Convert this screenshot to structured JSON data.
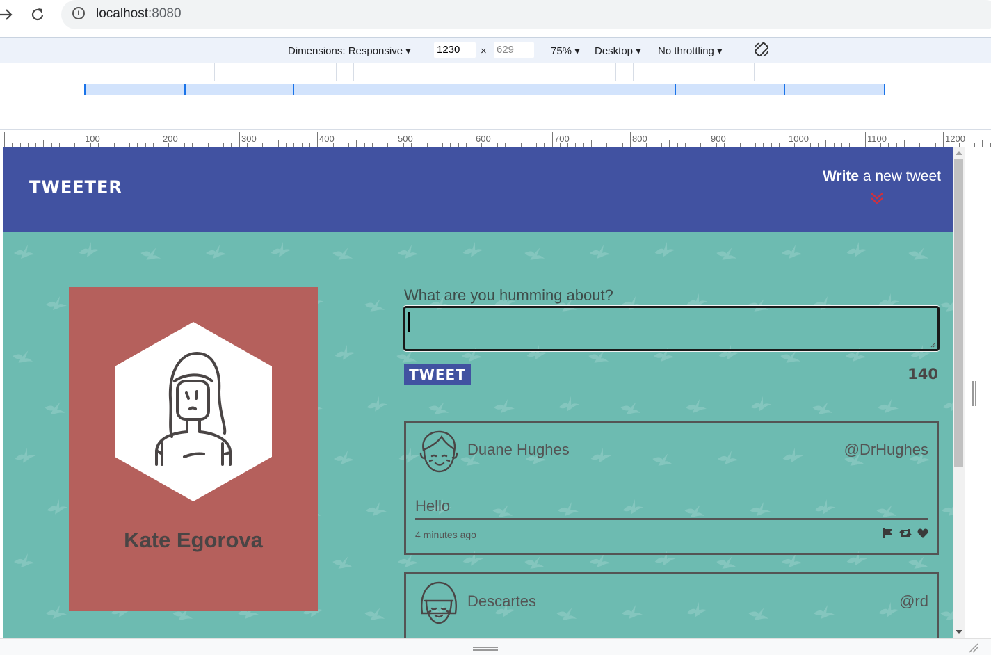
{
  "browser": {
    "url_host": "localhost",
    "url_port": ":8080",
    "icons": [
      "forward-arrow-icon",
      "reload-icon",
      "info-icon"
    ]
  },
  "devtools": {
    "dimensions_label": "Dimensions: Responsive",
    "width_value": "1230",
    "times": "×",
    "height_placeholder": "629",
    "zoom": "75%",
    "device": "Desktop",
    "throttling": "No throttling",
    "ruler_labels": [
      "100",
      "200",
      "300",
      "400",
      "500",
      "600",
      "700",
      "800",
      "900",
      "1000",
      "1100",
      "1200"
    ]
  },
  "header": {
    "logo": "TWEETER",
    "write_bold": "Write",
    "write_rest": " a new tweet",
    "accent_color": "#4152a1"
  },
  "profile": {
    "name": "Kate Egorova",
    "card_color": "#b5605c"
  },
  "composer": {
    "label": "What are you humming about?",
    "button": "TWEET",
    "counter": "140"
  },
  "tweets": [
    {
      "name": "Duane Hughes",
      "handle": "@DrHughes",
      "text": "Hello",
      "time": "4 minutes ago",
      "actions": [
        "flag-icon",
        "retweet-icon",
        "heart-icon"
      ]
    },
    {
      "name": "Descartes",
      "handle": "@rd"
    }
  ],
  "colors": {
    "background": "#6dbbb1",
    "text": "#545454"
  }
}
